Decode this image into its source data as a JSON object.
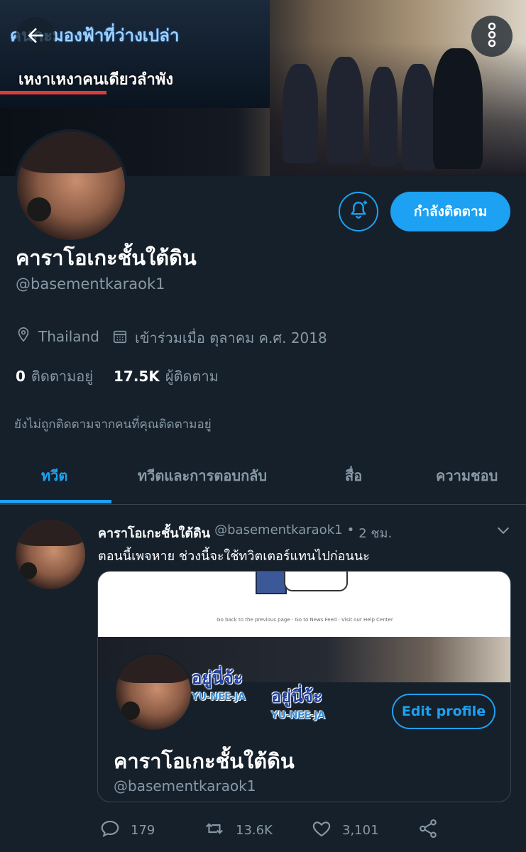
{
  "banner": {
    "karaoke_line1": "คนกะมองฟ้าที่ว่างเปล่า",
    "karaoke_line2": "เหงาเหงาคนเดียวลำพัง"
  },
  "profile": {
    "name": "คาราโอเกะชั้นใต้ดิน",
    "handle": "@basementkaraok1",
    "location": "Thailand",
    "joined": "เข้าร่วมเมื่อ ตุลาคม ค.ศ. 2018",
    "following_count": "0",
    "following_label": "ติดตามอยู่",
    "followers_count": "17.5K",
    "followers_label": "ผู้ติดตาม",
    "not_followed_note": "ยังไม่ถูกติดตามจากคนที่คุณติดตามอยู่",
    "follow_button": "กำลังติดตาม"
  },
  "tabs": [
    {
      "label": "ทวีต",
      "active": true
    },
    {
      "label": "ทวีตและการตอบกลับ",
      "active": false
    },
    {
      "label": "สื่อ",
      "active": false
    },
    {
      "label": "ความชอบ",
      "active": false
    }
  ],
  "tweet": {
    "author_name": "คาราโอเกะชั้นใต้ดิน",
    "author_handle": "@basementkaraok1",
    "separator": "•",
    "time": "2 ชม.",
    "text": "ตอนนี้เพจหาย ช่วงนี้จะใช้ทวิตเตอร์แทนไปก่อนนะ",
    "card": {
      "fb_footer": "Go back to the previous page · Go to News Feed · Visit our Help Center",
      "sticker_main": "อยู่นี่จ้ะ",
      "sticker_sub": "YU-NEE-JA",
      "edit_profile": "Edit profile",
      "name": "คาราโอเกะชั้นใต้ดิน",
      "handle": "@basementkaraok1"
    },
    "replies": "179",
    "retweets": "13.6K",
    "likes": "3,101"
  },
  "colors": {
    "background": "#15202b",
    "accent": "#1da1f2",
    "secondary_text": "#8899a6",
    "divider": "#38444d"
  },
  "icons": [
    "back-arrow-icon",
    "more-vertical-icon",
    "bell-plus-icon",
    "location-pin-icon",
    "calendar-icon",
    "chevron-down-icon",
    "reply-icon",
    "retweet-icon",
    "like-icon",
    "share-icon"
  ]
}
